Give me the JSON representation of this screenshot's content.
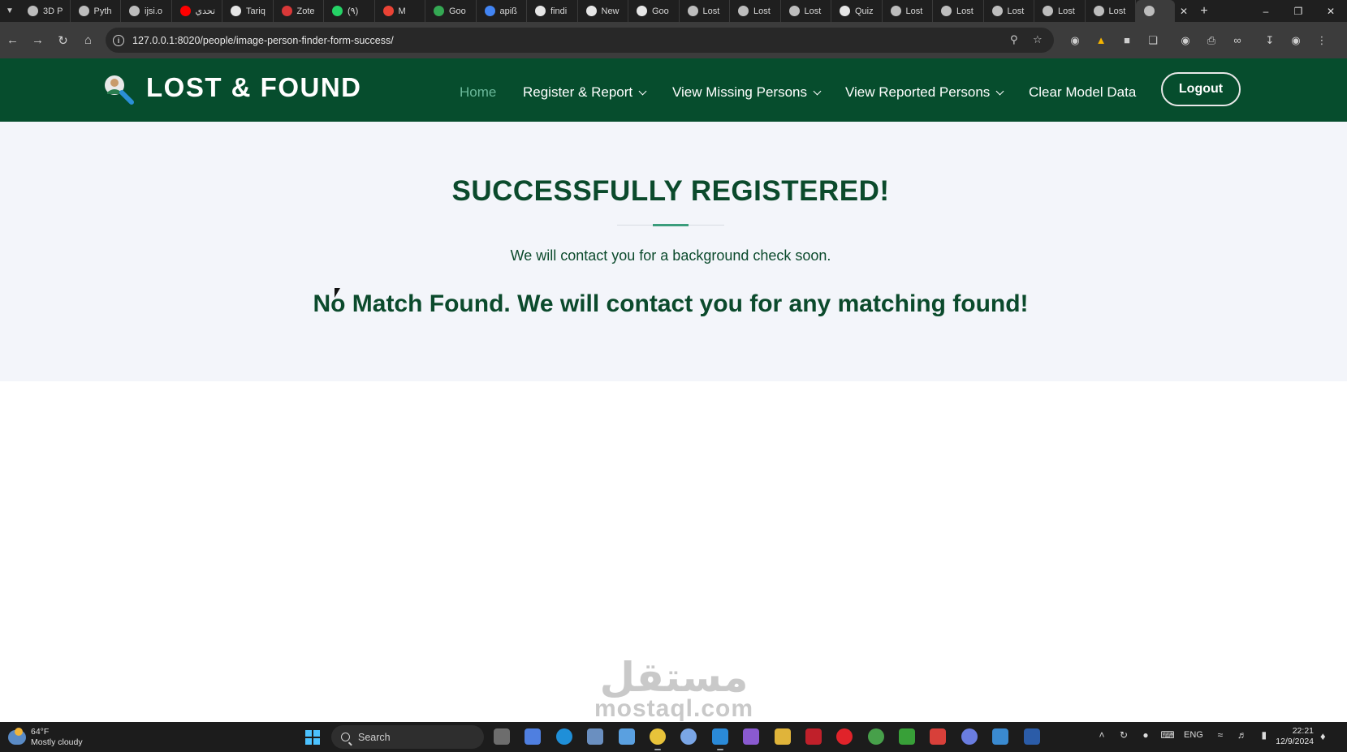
{
  "browser": {
    "tabs": [
      {
        "title": "3D P",
        "color": "#bdbdbd"
      },
      {
        "title": "Pyth",
        "color": "#bdbdbd"
      },
      {
        "title": "ijsi.o",
        "color": "#bdbdbd"
      },
      {
        "title": "تحدي",
        "color": "#ff0000"
      },
      {
        "title": "Tariq",
        "color": "#e6e6e6"
      },
      {
        "title": "Zote",
        "color": "#d93838"
      },
      {
        "title": "(٩)",
        "color": "#25d366"
      },
      {
        "title": "M",
        "color": "#ea4335"
      },
      {
        "title": "Goo",
        "color": "#34a853"
      },
      {
        "title": "apiß",
        "color": "#4285f4"
      },
      {
        "title": "findi",
        "color": "#e6e6e6"
      },
      {
        "title": "New",
        "color": "#e6e6e6"
      },
      {
        "title": "Goo",
        "color": "#e6e6e6"
      },
      {
        "title": "Lost",
        "color": "#bdbdbd"
      },
      {
        "title": "Lost",
        "color": "#bdbdbd"
      },
      {
        "title": "Lost",
        "color": "#bdbdbd"
      },
      {
        "title": "Quiz",
        "color": "#e6e6e6"
      },
      {
        "title": "Lost",
        "color": "#bdbdbd"
      },
      {
        "title": "Lost",
        "color": "#bdbdbd"
      },
      {
        "title": "Lost",
        "color": "#bdbdbd"
      },
      {
        "title": "Lost",
        "color": "#bdbdbd"
      },
      {
        "title": "Lost",
        "color": "#bdbdbd"
      }
    ],
    "url": "127.0.0.1:8020/people/image-person-finder-form-success/"
  },
  "site": {
    "brand": "LOST & FOUND",
    "nav": {
      "home": "Home",
      "register": "Register & Report",
      "missing": "View Missing Persons",
      "reported": "View Reported Persons",
      "clear": "Clear Model Data",
      "logout": "Logout"
    },
    "colors": {
      "navbar": "#064d2d",
      "accent": "#3b9d7c",
      "text": "#0b4a2c"
    }
  },
  "result": {
    "title": "SUCCESSFULLY REGISTERED!",
    "subtitle": "We will contact you for a background check soon.",
    "match_message": "No Match Found. We will contact you for any matching found!"
  },
  "watermark": {
    "arabic": "مستقل",
    "latin": "mostaql.com"
  },
  "taskbar": {
    "weather_temp": "64°F",
    "weather_desc": "Mostly cloudy",
    "search_placeholder": "Search",
    "lang": "ENG",
    "time": "22:21",
    "date": "12/9/2024"
  }
}
